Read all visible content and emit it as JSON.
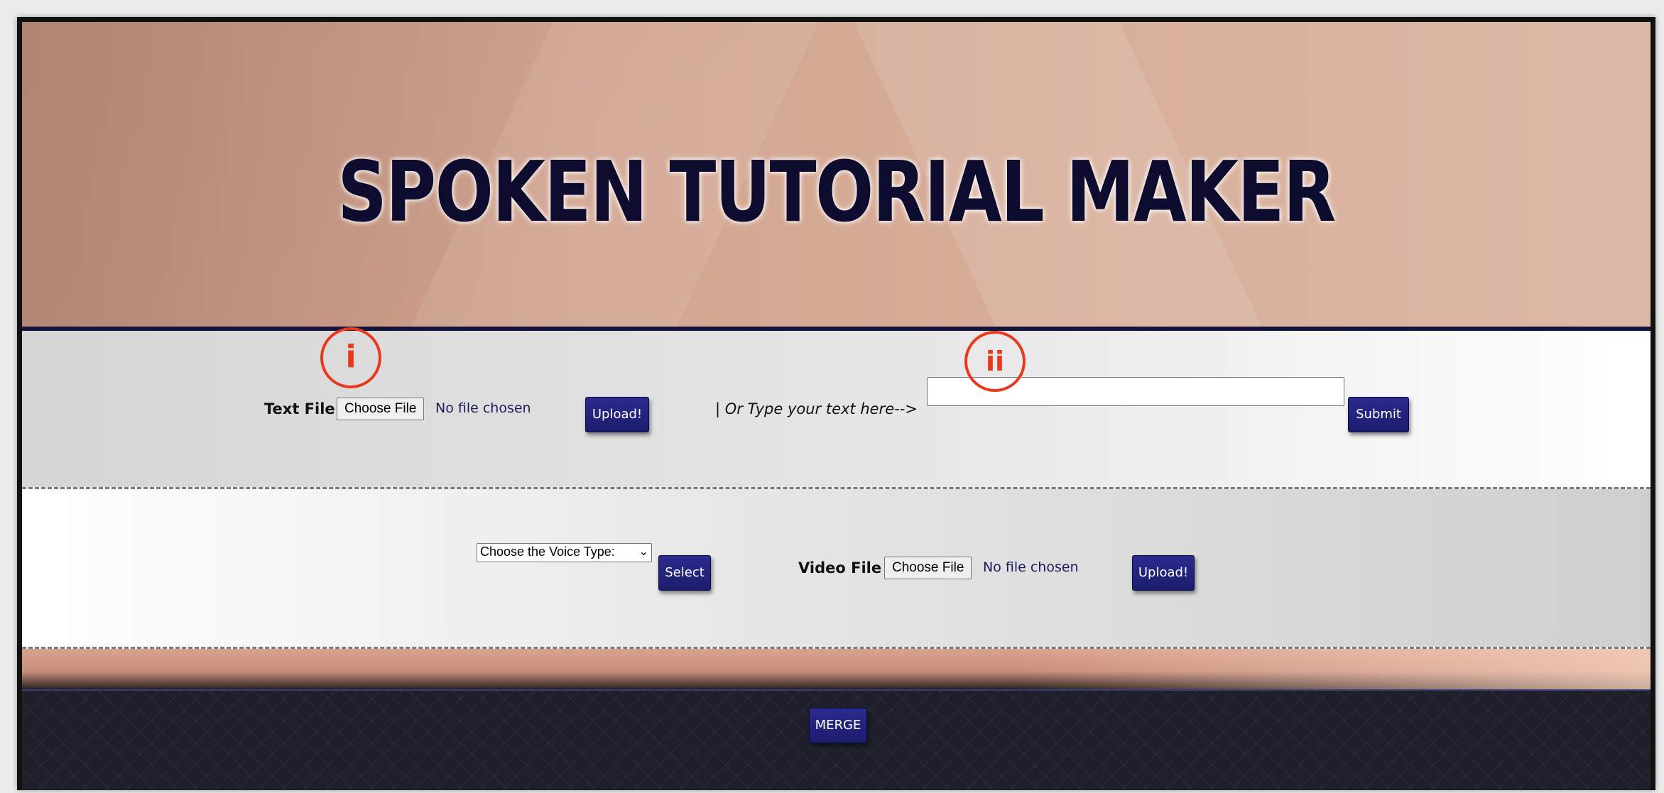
{
  "header": {
    "title": "SPOKEN TUTORIAL MAKER"
  },
  "row1": {
    "text_file_label": "Text File :",
    "choose_file_label": "Choose File",
    "file_status": "No file chosen",
    "upload_label": "Upload!",
    "type_prompt": "| Or Type your text here-->",
    "text_value": "",
    "submit_label": "Submit"
  },
  "row2": {
    "voice_select_value": "Choose the Voice Type:",
    "select_label": "Select",
    "video_file_label": "Video File :",
    "choose_file_label": "Choose File",
    "file_status": "No file chosen",
    "upload_label": "Upload!"
  },
  "footer": {
    "merge_label": "MERGE"
  },
  "annotations": {
    "first": "i",
    "second": "ii"
  },
  "colors": {
    "button": "#1f1f75",
    "annotation": "#e8391c",
    "title": "#0d0b2e",
    "footer": "#1d1f2a"
  }
}
